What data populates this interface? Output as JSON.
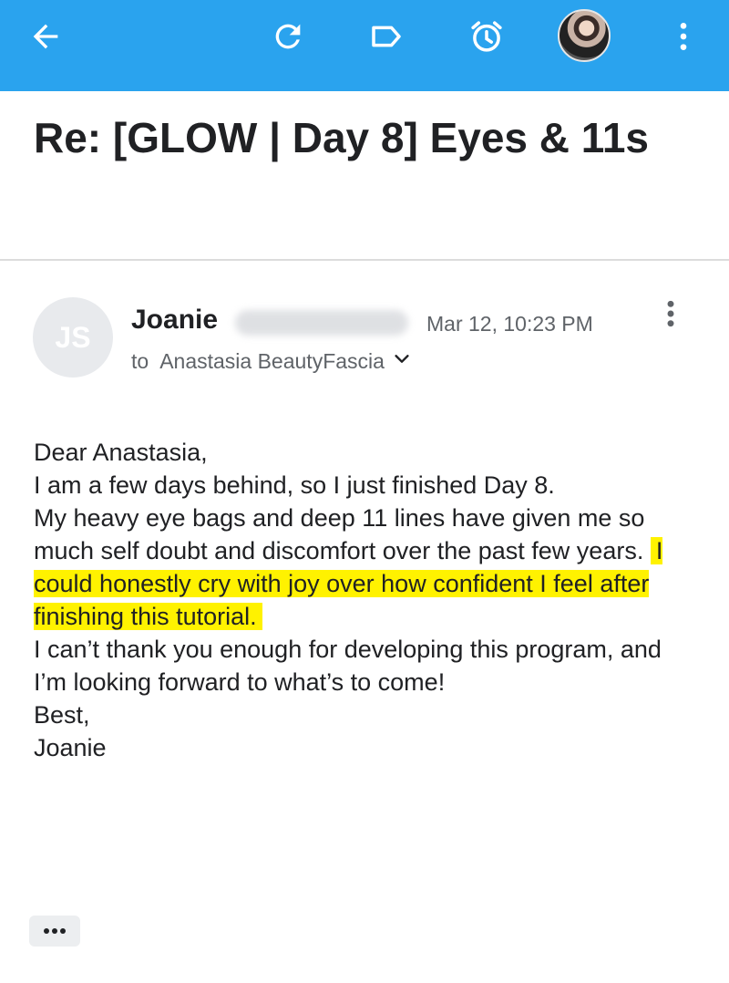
{
  "toolbar": {
    "background_color": "#2aa3ee",
    "icons": [
      "back-arrow-icon",
      "refresh-icon",
      "label-icon",
      "snooze-alarm-icon",
      "avatar",
      "more-vert-icon"
    ]
  },
  "email": {
    "subject": "Re: [GLOW | Day 8] Eyes & 11s",
    "sender": {
      "initials": "JS",
      "first_name": "Joanie",
      "date": "Mar 12, 10:23 PM",
      "to_label": "to",
      "recipient": "Anastasia BeautyFascia"
    },
    "body": {
      "line1": "Dear Anastasia,",
      "line2": "I am a few days behind, so I just finished Day 8.",
      "line3_plain": "My heavy eye bags and deep 11 lines have given me so much self doubt and discomfort over the past few years. ",
      "line3_highlight": "I could honestly cry with joy over how confident I feel after finishing this tutorial.",
      "line4": "I can’t thank you enough for developing this program, and I’m looking forward to what’s to come!",
      "line5": "Best,",
      "line6": "Joanie"
    },
    "highlight_color": "#fff200",
    "trimmed_label": "•••"
  }
}
